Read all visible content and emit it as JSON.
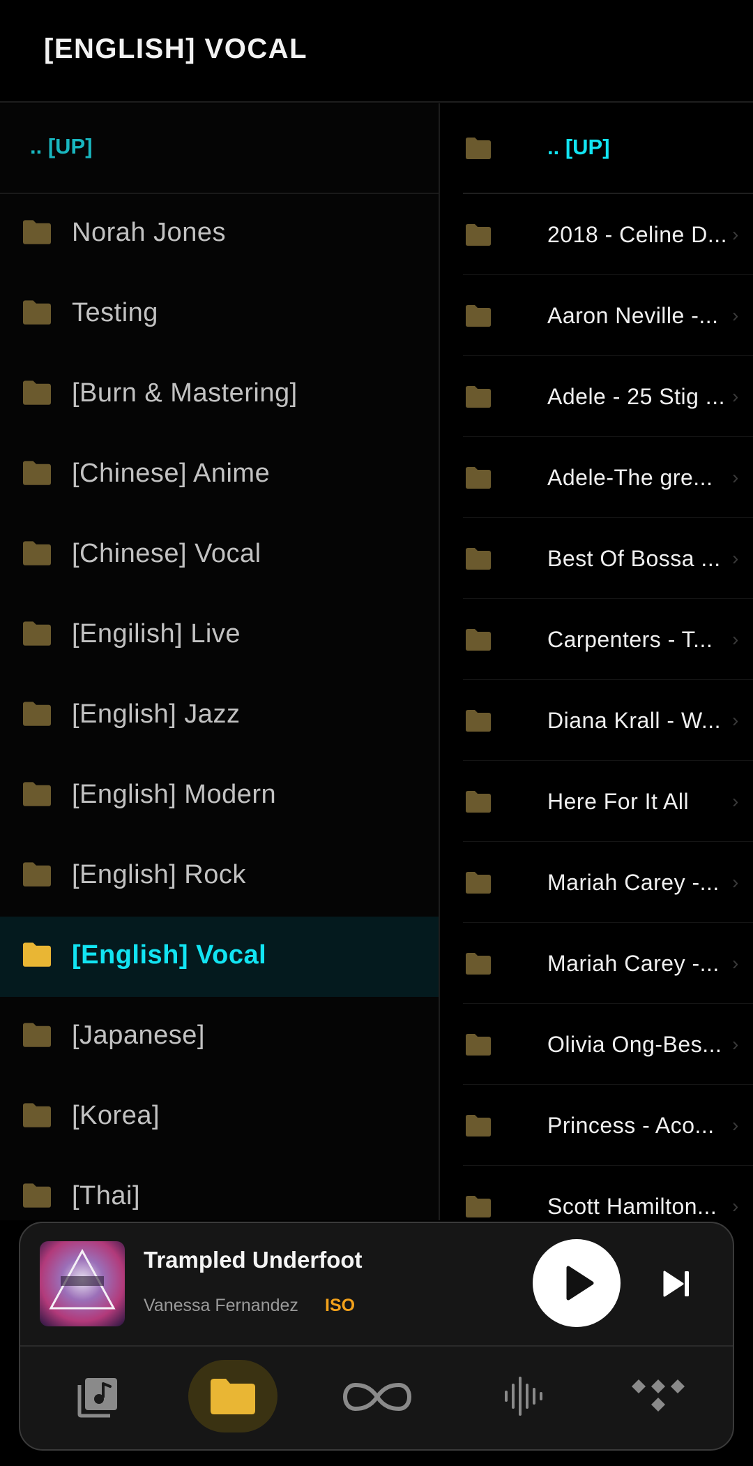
{
  "header": {
    "title": "[ENGLISH] VOCAL"
  },
  "left_pane": {
    "up_label": ".. [UP]",
    "items": [
      {
        "label": "Norah Jones"
      },
      {
        "label": "Testing"
      },
      {
        "label": "[Burn & Mastering]"
      },
      {
        "label": "[Chinese] Anime"
      },
      {
        "label": "[Chinese] Vocal"
      },
      {
        "label": "[Engilish] Live"
      },
      {
        "label": "[English] Jazz"
      },
      {
        "label": "[English] Modern"
      },
      {
        "label": "[English] Rock"
      },
      {
        "label": "[English] Vocal"
      },
      {
        "label": "[Japanese]"
      },
      {
        "label": "[Korea]"
      },
      {
        "label": "[Thai]"
      }
    ]
  },
  "right_pane": {
    "up_label": ".. [UP]",
    "items": [
      {
        "label": "2018 - Celine D..."
      },
      {
        "label": "Aaron Neville -..."
      },
      {
        "label": "Adele - 25 Stig ..."
      },
      {
        "label": "Adele-The gre..."
      },
      {
        "label": "Best Of Bossa ..."
      },
      {
        "label": "Carpenters - T..."
      },
      {
        "label": "Diana Krall - W..."
      },
      {
        "label": "Here For It All"
      },
      {
        "label": "Mariah Carey -..."
      },
      {
        "label": "Mariah Carey -..."
      },
      {
        "label": "Olivia Ong-Bes..."
      },
      {
        "label": "Princess - Aco..."
      },
      {
        "label": "Scott Hamilton..."
      }
    ]
  },
  "player": {
    "track_title": "Trampled Underfoot",
    "artist": "Vanessa Fernandez",
    "format_badge": "ISO",
    "play_icon": "play-icon",
    "next_icon": "skip-next-icon"
  },
  "bottom_nav": {
    "items": [
      {
        "icon": "music-library-icon"
      },
      {
        "icon": "folder-icon",
        "active": true
      },
      {
        "icon": "infinity-icon"
      },
      {
        "icon": "waveform-icon"
      },
      {
        "icon": "tidal-icon"
      }
    ]
  },
  "colors": {
    "accent_cyan": "#12e4f2",
    "folder_dim": "#6b5a2e",
    "folder_active": "#e9b634",
    "format_badge": "#f2a11b"
  }
}
